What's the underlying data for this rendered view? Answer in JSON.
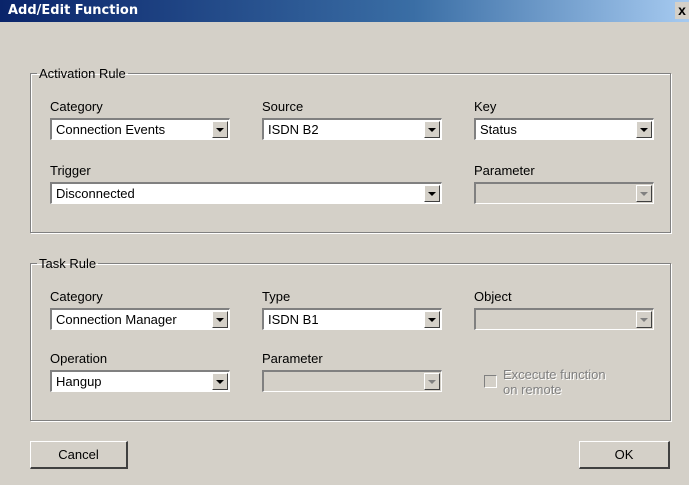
{
  "window": {
    "title": "Add/Edit Function",
    "close_label": "x"
  },
  "activation": {
    "legend": "Activation Rule",
    "category_label": "Category",
    "category_value": "Connection Events",
    "source_label": "Source",
    "source_value": "ISDN B2",
    "key_label": "Key",
    "key_value": "Status",
    "trigger_label": "Trigger",
    "trigger_value": "Disconnected",
    "parameter_label": "Parameter",
    "parameter_value": ""
  },
  "task": {
    "legend": "Task Rule",
    "category_label": "Category",
    "category_value": "Connection Manager",
    "type_label": "Type",
    "type_value": "ISDN B1",
    "object_label": "Object",
    "object_value": "",
    "operation_label": "Operation",
    "operation_value": "Hangup",
    "parameter_label": "Parameter",
    "parameter_value": "",
    "execute_label_line1": "Excecute function",
    "execute_label_line2": "on remote",
    "execute_checked": false
  },
  "buttons": {
    "cancel": "Cancel",
    "ok": "OK"
  }
}
